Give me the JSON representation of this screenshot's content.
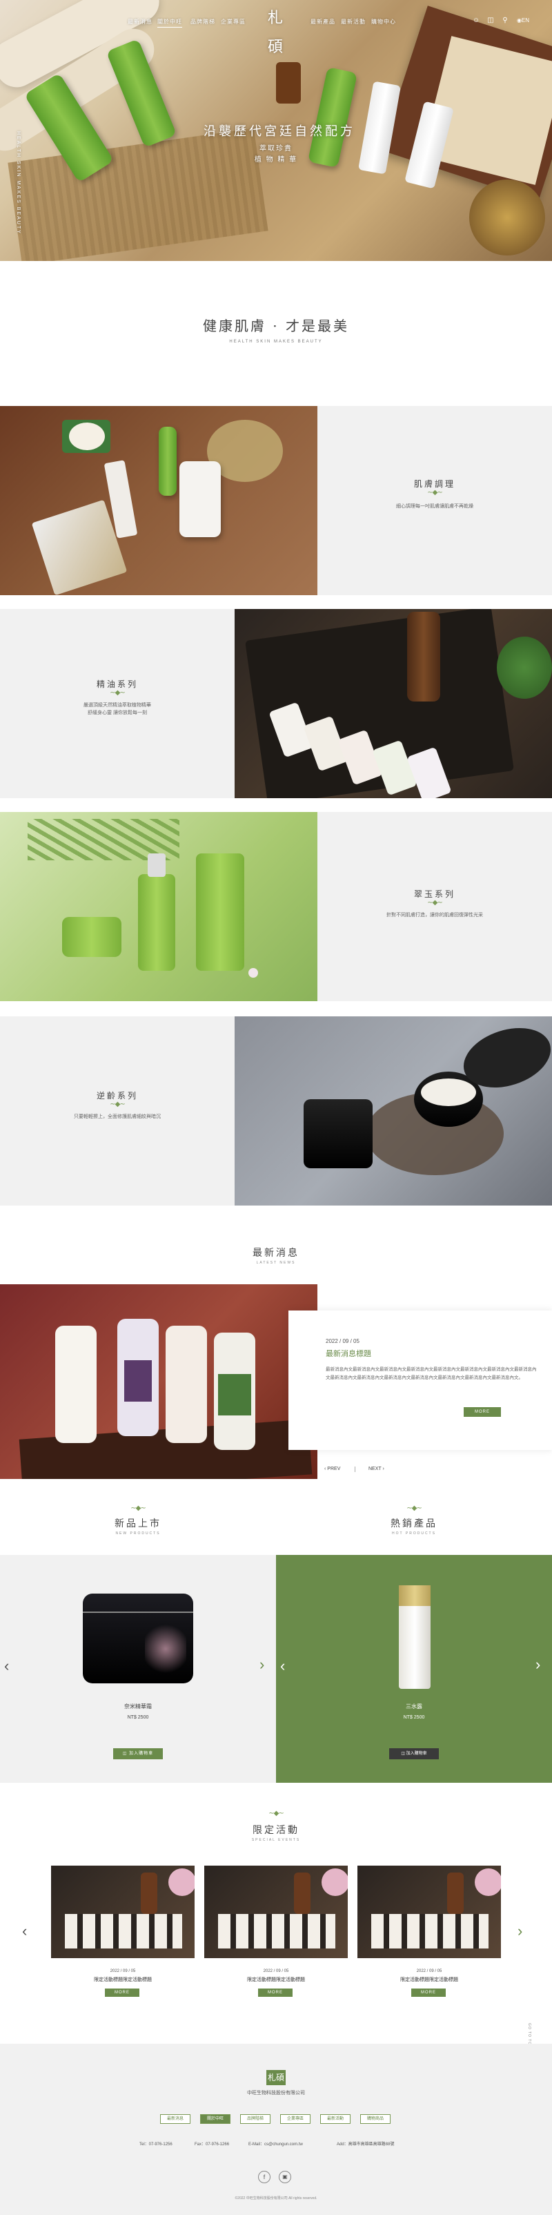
{
  "brand": {
    "logo_text": "札碩",
    "company_name": "中旺生物科技股份有限公司"
  },
  "nav": {
    "left": [
      "最新消息",
      "關於中旺",
      "品牌階梯",
      "企業專區"
    ],
    "right": [
      "最新產品",
      "最新活動",
      "購物中心"
    ],
    "lang": "EN",
    "active_index": 1
  },
  "hero": {
    "title": "沿襲歷代宮廷自然配方",
    "subtitle1": "萃取珍貴",
    "subtitle2": "植 物 精 華",
    "vertical_text": "HEALTH SKIN MAKES BEAUTY"
  },
  "intro": {
    "title": "健康肌膚 · 才是最美",
    "subtitle": "HEALTH SKIN MAKES BEAUTY"
  },
  "series": [
    {
      "title": "肌膚調理",
      "desc": "細心調理每一吋肌膚讓肌膚不再乾燥"
    },
    {
      "title": "精油系列",
      "desc": "嚴選頂級天然精油萃取植物精華\n舒緩身心靈 讓你放鬆每一刻"
    },
    {
      "title": "翠玉系列",
      "desc": "針對不同肌膚打造，讓你的肌膚回復彈性光采"
    },
    {
      "title": "逆齡系列",
      "desc": "只要輕輕擦上，全面修護肌膚細紋與暗沉"
    }
  ],
  "news": {
    "title": "最新消息",
    "subtitle": "LATEST NEWS",
    "date": "2022 / 09 / 05",
    "headline": "最新消息標題",
    "body": "最新消息內文最新消息內文最新消息內文最新消息內文最新消息內文最新消息內文最新消息內文最新消息內文最新消息內文最新消息內文最新消息內文最新消息內文最新消息內文最新消息內文最新消息內文。",
    "more": "MORE",
    "prev": "PREV",
    "next": "NEXT"
  },
  "new_products": {
    "title": "新品上市",
    "subtitle": "NEW PRODUCTS",
    "name": "奈米精華霜",
    "price": "NT$ 2500",
    "cart": "加入購物車"
  },
  "hot_products": {
    "title": "熱銷產品",
    "subtitle": "HOT PRODUCTS",
    "name": "三水露",
    "price": "NT$ 2500",
    "cart": "加入購物車"
  },
  "events": {
    "title": "限定活動",
    "subtitle": "SPECIAL EVENTS",
    "items": [
      {
        "date": "2022 / 09 / 05",
        "title": "限定活動標題限定活動標題",
        "more": "MORE"
      },
      {
        "date": "2022 / 09 / 05",
        "title": "限定活動標題限定活動標題",
        "more": "MORE"
      },
      {
        "date": "2022 / 09 / 05",
        "title": "限定活動標題限定活動標題",
        "more": "MORE"
      }
    ]
  },
  "footer": {
    "tabs": [
      "最新消息",
      "關於中旺",
      "品牌階梯",
      "企業專區",
      "最新活動",
      "購物商品"
    ],
    "active_tab": 1,
    "tel": "Tel：07-976-1256",
    "fax": "Fax：07-976-1266",
    "email": "E-Mail：cs@chungun.com.tw",
    "address": "Add：高雄市高雄區高雄路88號",
    "copyright": "©2022 中旺生物科技股份有限公司 All rights reserved.",
    "goto_top": "GO TO TOP"
  },
  "colors": {
    "accent_green": "#6a8b4a",
    "dark_button": "#3a3a3a",
    "grey_bg": "#f1f1f1"
  }
}
